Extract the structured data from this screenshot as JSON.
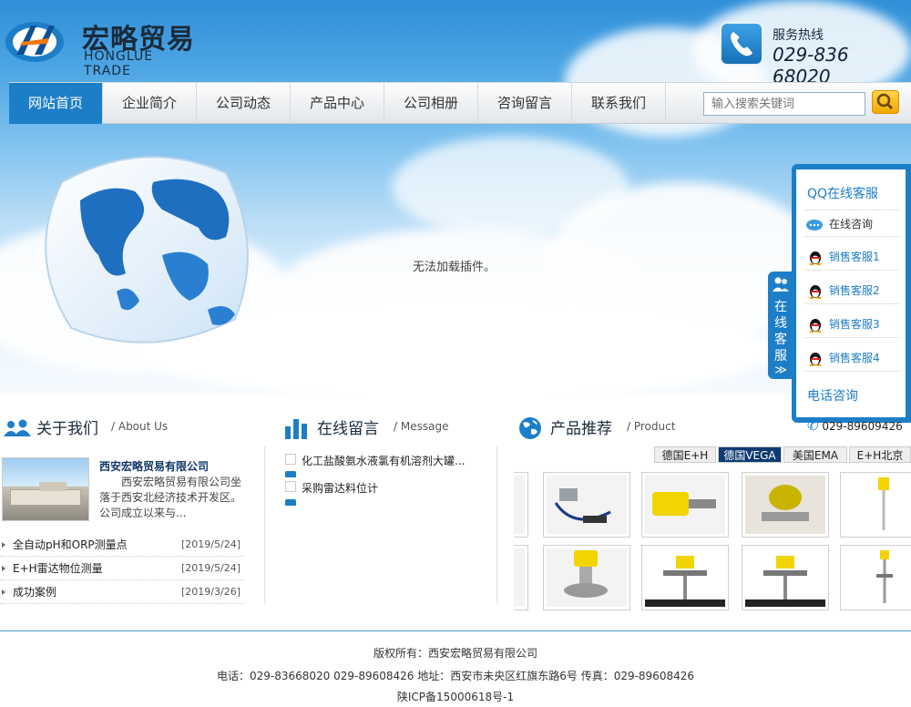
{
  "header": {
    "logo_cn": "宏略贸易",
    "logo_en": "HONGLUE TRADE",
    "hotline_label": "服务热线",
    "hotline_number": "029-836 68020"
  },
  "nav": {
    "items": [
      "网站首页",
      "企业简介",
      "公司动态",
      "产品中心",
      "公司相册",
      "咨询留言",
      "联系我们"
    ],
    "active_index": 0,
    "search_placeholder": "输入搜索关键词"
  },
  "banner": {
    "plugin_message": "无法加载插件。"
  },
  "service": {
    "tab_label": "在线客服",
    "tab_arrow": "≫",
    "qq_title": "QQ在线客服",
    "online_consult": "在线咨询",
    "agents": [
      "销售客服1",
      "销售客服2",
      "销售客服3",
      "销售客服4"
    ],
    "phone_title": "电话咨询",
    "phone_number": "029-89609426"
  },
  "about": {
    "title": "关于我们",
    "subtitle": "/ About Us",
    "company_name": "西安宏略贸易有限公司",
    "description": "西安宏略贸易有限公司坐落于西安北经济技术开发区。公司成立以来与...",
    "news": [
      {
        "title": "全自动pH和ORP测量点",
        "date": "[2019/5/24]"
      },
      {
        "title": "E+H雷达物位测量",
        "date": "[2019/5/24]"
      },
      {
        "title": "成功案例",
        "date": "[2019/3/26]"
      }
    ]
  },
  "message": {
    "title": "在线留言",
    "subtitle": "/ Message",
    "items": [
      "化工盐酸氨水液氯有机溶剂大罐...",
      "采购雷达料位计"
    ]
  },
  "products": {
    "title": "产品推荐",
    "subtitle": "/ Product",
    "tabs": [
      "德国E+H",
      "德国VEGA",
      "美国EMA",
      "E+H北京"
    ],
    "active_tab": 1
  },
  "footer": {
    "copyright": "版权所有：西安宏略贸易有限公司",
    "contact": "电话：029-83668020 029-89608426 地址：西安市未央区红旗东路6号 传真：029-89608426",
    "icp": "陕ICP备15000618号-1"
  },
  "colors": {
    "accent": "#1d7ec8",
    "dark_tab": "#0d3a73",
    "search_button": "#f0a800"
  }
}
